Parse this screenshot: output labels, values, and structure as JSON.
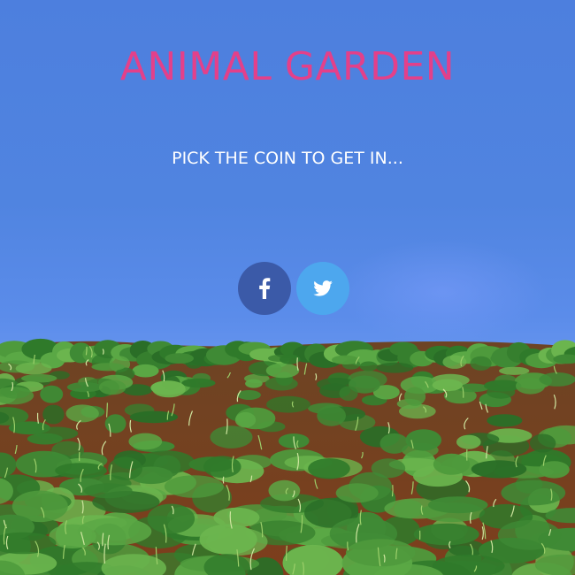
{
  "page": {
    "title": "ANIMAL GARDEN",
    "subtitle": "PICK THE COIN TO GET IN..."
  },
  "colors": {
    "sky": "#4f82df",
    "title": "#e3408a",
    "subtitle": "#ffffff",
    "facebook": "#3b5aa8",
    "twitter": "#4da7ee",
    "grass": "#3f8a35",
    "soil": "#7a3f1d"
  },
  "social": [
    {
      "name": "facebook",
      "icon": "facebook-icon"
    },
    {
      "name": "twitter",
      "icon": "twitter-icon"
    }
  ]
}
